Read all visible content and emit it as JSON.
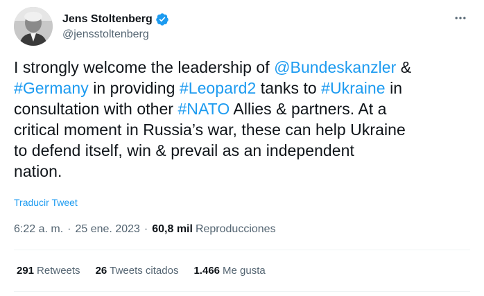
{
  "author": {
    "display_name": "Jens Stoltenberg",
    "handle": "@jensstoltenberg",
    "avatar_icon": "person-portrait-avatar",
    "verified_icon": "verified-badge-icon",
    "verified_color": "#1d9bf0"
  },
  "tweet": {
    "lines": [
      [
        {
          "text": "I strongly welcome the leadership of ",
          "link": false
        },
        {
          "text": "@Bundeskanzler",
          "link": true
        },
        {
          "text": " &",
          "link": false
        }
      ],
      [
        {
          "text": "#Germany",
          "link": true
        },
        {
          "text": " in providing ",
          "link": false
        },
        {
          "text": "#Leopard2",
          "link": true
        },
        {
          "text": " tanks to ",
          "link": false
        },
        {
          "text": "#Ukraine",
          "link": true
        },
        {
          "text": " in",
          "link": false
        }
      ],
      [
        {
          "text": "consultation with other ",
          "link": false
        },
        {
          "text": "#NATO",
          "link": true
        },
        {
          "text": " Allies & partners. At a",
          "link": false
        }
      ],
      [
        {
          "text": "critical moment in Russia’s war, these can help Ukraine",
          "link": false
        }
      ],
      [
        {
          "text": "to defend itself, win & prevail as an independent",
          "link": false
        }
      ],
      [
        {
          "text": "nation.",
          "link": false
        }
      ]
    ],
    "translate_label": "Traducir Tweet",
    "link_color": "#1d9bf0"
  },
  "meta": {
    "time": "6:22 a. m.",
    "separator": "·",
    "date": "25 ene. 2023",
    "views_count": "60,8 mil",
    "views_label": "Reproducciones"
  },
  "stats": {
    "retweets_count": "291",
    "retweets_label": "Retweets",
    "quotes_count": "26",
    "quotes_label": "Tweets citados",
    "likes_count": "1.466",
    "likes_label": "Me gusta"
  },
  "more_icon": "more-horizontal-icon"
}
